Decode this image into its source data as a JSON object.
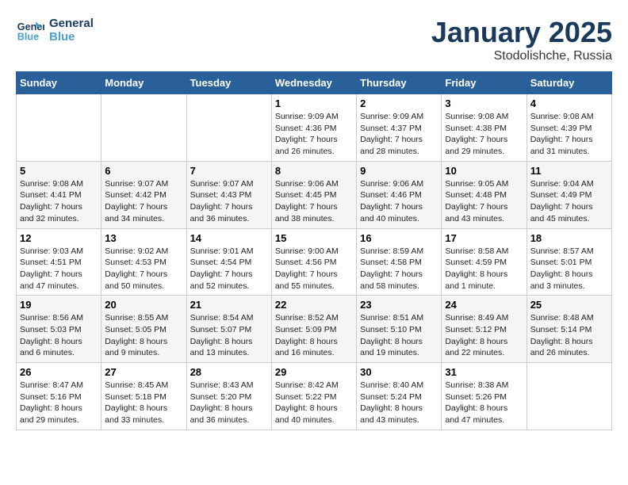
{
  "logo": {
    "line1": "General",
    "line2": "Blue"
  },
  "title": "January 2025",
  "location": "Stodolishche, Russia",
  "days_of_week": [
    "Sunday",
    "Monday",
    "Tuesday",
    "Wednesday",
    "Thursday",
    "Friday",
    "Saturday"
  ],
  "weeks": [
    [
      {
        "day": "",
        "info": ""
      },
      {
        "day": "",
        "info": ""
      },
      {
        "day": "",
        "info": ""
      },
      {
        "day": "1",
        "info": "Sunrise: 9:09 AM\nSunset: 4:36 PM\nDaylight: 7 hours\nand 26 minutes."
      },
      {
        "day": "2",
        "info": "Sunrise: 9:09 AM\nSunset: 4:37 PM\nDaylight: 7 hours\nand 28 minutes."
      },
      {
        "day": "3",
        "info": "Sunrise: 9:08 AM\nSunset: 4:38 PM\nDaylight: 7 hours\nand 29 minutes."
      },
      {
        "day": "4",
        "info": "Sunrise: 9:08 AM\nSunset: 4:39 PM\nDaylight: 7 hours\nand 31 minutes."
      }
    ],
    [
      {
        "day": "5",
        "info": "Sunrise: 9:08 AM\nSunset: 4:41 PM\nDaylight: 7 hours\nand 32 minutes."
      },
      {
        "day": "6",
        "info": "Sunrise: 9:07 AM\nSunset: 4:42 PM\nDaylight: 7 hours\nand 34 minutes."
      },
      {
        "day": "7",
        "info": "Sunrise: 9:07 AM\nSunset: 4:43 PM\nDaylight: 7 hours\nand 36 minutes."
      },
      {
        "day": "8",
        "info": "Sunrise: 9:06 AM\nSunset: 4:45 PM\nDaylight: 7 hours\nand 38 minutes."
      },
      {
        "day": "9",
        "info": "Sunrise: 9:06 AM\nSunset: 4:46 PM\nDaylight: 7 hours\nand 40 minutes."
      },
      {
        "day": "10",
        "info": "Sunrise: 9:05 AM\nSunset: 4:48 PM\nDaylight: 7 hours\nand 43 minutes."
      },
      {
        "day": "11",
        "info": "Sunrise: 9:04 AM\nSunset: 4:49 PM\nDaylight: 7 hours\nand 45 minutes."
      }
    ],
    [
      {
        "day": "12",
        "info": "Sunrise: 9:03 AM\nSunset: 4:51 PM\nDaylight: 7 hours\nand 47 minutes."
      },
      {
        "day": "13",
        "info": "Sunrise: 9:02 AM\nSunset: 4:53 PM\nDaylight: 7 hours\nand 50 minutes."
      },
      {
        "day": "14",
        "info": "Sunrise: 9:01 AM\nSunset: 4:54 PM\nDaylight: 7 hours\nand 52 minutes."
      },
      {
        "day": "15",
        "info": "Sunrise: 9:00 AM\nSunset: 4:56 PM\nDaylight: 7 hours\nand 55 minutes."
      },
      {
        "day": "16",
        "info": "Sunrise: 8:59 AM\nSunset: 4:58 PM\nDaylight: 7 hours\nand 58 minutes."
      },
      {
        "day": "17",
        "info": "Sunrise: 8:58 AM\nSunset: 4:59 PM\nDaylight: 8 hours\nand 1 minute."
      },
      {
        "day": "18",
        "info": "Sunrise: 8:57 AM\nSunset: 5:01 PM\nDaylight: 8 hours\nand 3 minutes."
      }
    ],
    [
      {
        "day": "19",
        "info": "Sunrise: 8:56 AM\nSunset: 5:03 PM\nDaylight: 8 hours\nand 6 minutes."
      },
      {
        "day": "20",
        "info": "Sunrise: 8:55 AM\nSunset: 5:05 PM\nDaylight: 8 hours\nand 9 minutes."
      },
      {
        "day": "21",
        "info": "Sunrise: 8:54 AM\nSunset: 5:07 PM\nDaylight: 8 hours\nand 13 minutes."
      },
      {
        "day": "22",
        "info": "Sunrise: 8:52 AM\nSunset: 5:09 PM\nDaylight: 8 hours\nand 16 minutes."
      },
      {
        "day": "23",
        "info": "Sunrise: 8:51 AM\nSunset: 5:10 PM\nDaylight: 8 hours\nand 19 minutes."
      },
      {
        "day": "24",
        "info": "Sunrise: 8:49 AM\nSunset: 5:12 PM\nDaylight: 8 hours\nand 22 minutes."
      },
      {
        "day": "25",
        "info": "Sunrise: 8:48 AM\nSunset: 5:14 PM\nDaylight: 8 hours\nand 26 minutes."
      }
    ],
    [
      {
        "day": "26",
        "info": "Sunrise: 8:47 AM\nSunset: 5:16 PM\nDaylight: 8 hours\nand 29 minutes."
      },
      {
        "day": "27",
        "info": "Sunrise: 8:45 AM\nSunset: 5:18 PM\nDaylight: 8 hours\nand 33 minutes."
      },
      {
        "day": "28",
        "info": "Sunrise: 8:43 AM\nSunset: 5:20 PM\nDaylight: 8 hours\nand 36 minutes."
      },
      {
        "day": "29",
        "info": "Sunrise: 8:42 AM\nSunset: 5:22 PM\nDaylight: 8 hours\nand 40 minutes."
      },
      {
        "day": "30",
        "info": "Sunrise: 8:40 AM\nSunset: 5:24 PM\nDaylight: 8 hours\nand 43 minutes."
      },
      {
        "day": "31",
        "info": "Sunrise: 8:38 AM\nSunset: 5:26 PM\nDaylight: 8 hours\nand 47 minutes."
      },
      {
        "day": "",
        "info": ""
      }
    ]
  ]
}
